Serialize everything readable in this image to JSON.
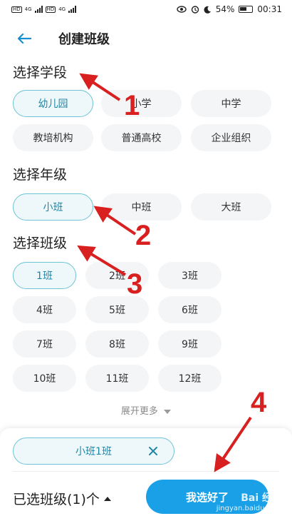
{
  "status_bar": {
    "sim1": "HD",
    "sim2": "HD",
    "net1": "4G",
    "net2": "4G",
    "battery": "54%",
    "time": "00:31",
    "icons": [
      "eye-icon",
      "alarm-icon",
      "moon-icon",
      "battery-icon"
    ]
  },
  "header": {
    "title": "创建班级",
    "back_icon": "arrow-left-icon"
  },
  "stage": {
    "title": "选择学段",
    "options": [
      "幼儿园",
      "小学",
      "中学",
      "教培机构",
      "普通高校",
      "企业组织"
    ],
    "selected": "幼儿园"
  },
  "grade": {
    "title": "选择年级",
    "options": [
      "小班",
      "中班",
      "大班"
    ],
    "selected": "小班"
  },
  "class": {
    "title": "选择班级",
    "options": [
      "1班",
      "2班",
      "3班",
      "4班",
      "5班",
      "6班",
      "7班",
      "8班",
      "9班",
      "10班",
      "11班",
      "12班"
    ],
    "selected": "1班"
  },
  "more": {
    "label": "展开更多"
  },
  "bottom": {
    "tag": "小班1班",
    "count_label": "已选班级(1)个",
    "confirm": "我选好了"
  },
  "annotations": [
    "1",
    "2",
    "3",
    "4"
  ],
  "watermark": {
    "brand": "Bai 经验",
    "url": "jingyan.baidu.com"
  },
  "colors": {
    "accent": "#1aa0e6",
    "selected_border": "#6fc3d6",
    "selected_text": "#1f86a6",
    "annotation": "#d7201f"
  }
}
